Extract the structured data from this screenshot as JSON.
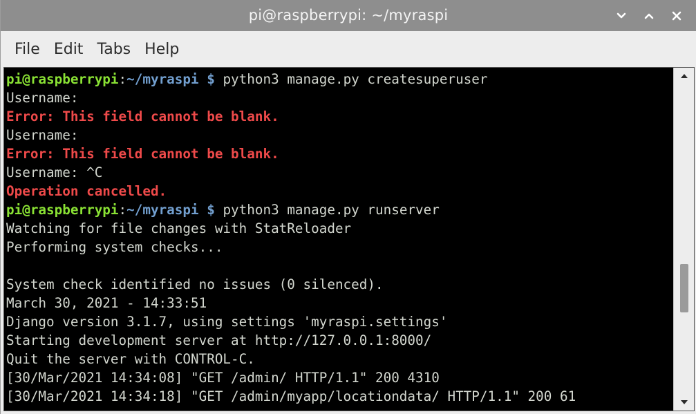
{
  "window": {
    "title": "pi@raspberrypi: ~/myraspi"
  },
  "menu": {
    "items": [
      "File",
      "Edit",
      "Tabs",
      "Help"
    ]
  },
  "colors": {
    "prompt_user": "#8ae234",
    "prompt_path": "#729fcf",
    "error": "#ef4a4a",
    "text": "#d3d7cf",
    "background": "#000000"
  },
  "terminal": {
    "lines": [
      {
        "segments": [
          {
            "text": "pi@raspberrypi",
            "style": "green"
          },
          {
            "text": ":",
            "style": "plain"
          },
          {
            "text": "~/myraspi $",
            "style": "blue"
          },
          {
            "text": " python3 manage.py createsuperuser",
            "style": "plain"
          }
        ]
      },
      {
        "segments": [
          {
            "text": "Username:",
            "style": "plain"
          }
        ]
      },
      {
        "segments": [
          {
            "text": "Error: This field cannot be blank.",
            "style": "red"
          }
        ]
      },
      {
        "segments": [
          {
            "text": "Username:",
            "style": "plain"
          }
        ]
      },
      {
        "segments": [
          {
            "text": "Error: This field cannot be blank.",
            "style": "red"
          }
        ]
      },
      {
        "segments": [
          {
            "text": "Username: ^C",
            "style": "plain"
          }
        ]
      },
      {
        "segments": [
          {
            "text": "Operation cancelled.",
            "style": "red"
          }
        ]
      },
      {
        "segments": [
          {
            "text": "pi@raspberrypi",
            "style": "green"
          },
          {
            "text": ":",
            "style": "plain"
          },
          {
            "text": "~/myraspi $",
            "style": "blue"
          },
          {
            "text": " python3 manage.py runserver",
            "style": "plain"
          }
        ]
      },
      {
        "segments": [
          {
            "text": "Watching for file changes with StatReloader",
            "style": "plain"
          }
        ]
      },
      {
        "segments": [
          {
            "text": "Performing system checks...",
            "style": "plain"
          }
        ]
      },
      {
        "segments": [
          {
            "text": "",
            "style": "plain"
          }
        ]
      },
      {
        "segments": [
          {
            "text": "System check identified no issues (0 silenced).",
            "style": "plain"
          }
        ]
      },
      {
        "segments": [
          {
            "text": "March 30, 2021 - 14:33:51",
            "style": "plain"
          }
        ]
      },
      {
        "segments": [
          {
            "text": "Django version 3.1.7, using settings 'myraspi.settings'",
            "style": "plain"
          }
        ]
      },
      {
        "segments": [
          {
            "text": "Starting development server at http://127.0.0.1:8000/",
            "style": "plain"
          }
        ]
      },
      {
        "segments": [
          {
            "text": "Quit the server with CONTROL-C.",
            "style": "plain"
          }
        ]
      },
      {
        "segments": [
          {
            "text": "[30/Mar/2021 14:34:08] \"GET /admin/ HTTP/1.1\" 200 4310",
            "style": "plain"
          }
        ]
      },
      {
        "segments": [
          {
            "text": "[30/Mar/2021 14:34:18] \"GET /admin/myapp/locationdata/ HTTP/1.1\" 200 61",
            "style": "plain"
          }
        ]
      }
    ]
  },
  "icons": {
    "minimize": "chevron-down-icon",
    "maximize": "chevron-up-icon",
    "close": "close-icon"
  }
}
